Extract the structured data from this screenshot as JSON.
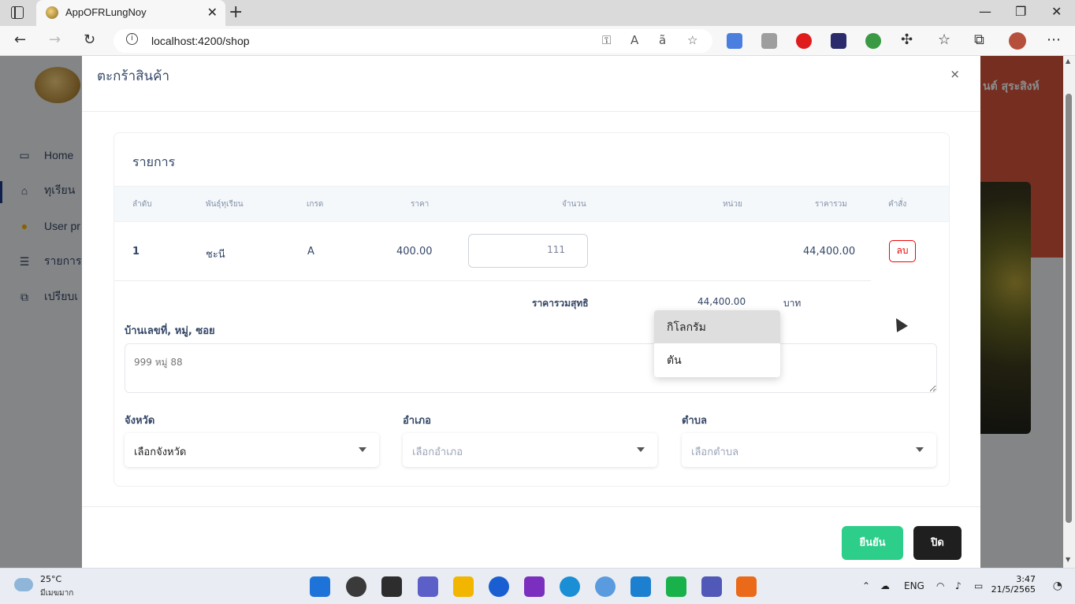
{
  "browser": {
    "tab_title": "AppOFRLungNoy",
    "tab_close": "✕",
    "new_tab": "+",
    "url": "localhost:4200/shop",
    "window_controls": [
      "—",
      "❐",
      "✕"
    ]
  },
  "background_page": {
    "sidebar": [
      {
        "label": "Home",
        "icon": "monitor-icon"
      },
      {
        "label": "ทุเรียน",
        "icon": "shop-icon"
      },
      {
        "label": "User pr",
        "icon": "user-icon"
      },
      {
        "label": "รายการ",
        "icon": "list-icon"
      },
      {
        "label": "เปรียบเ",
        "icon": "compare-icon"
      }
    ],
    "user_name": "นต์ สุระสิงห์"
  },
  "modal": {
    "title": "ตะกร้าสินค้า",
    "close_symbol": "×",
    "card_title": "รายการ",
    "columns": [
      "ลำดับ",
      "พันธุ์ทุเรียน",
      "เกรด",
      "ราคา",
      "จำนวน",
      "หน่วย",
      "ราคารวม",
      "คำสั่ง"
    ],
    "row": {
      "index": "1",
      "variety": "ชะนี",
      "grade": "A",
      "price": "400.00",
      "quantity": "111",
      "line_total": "44,400.00",
      "delete_label": "ลบ"
    },
    "unit_dropdown": {
      "options": [
        "กิโลกรัม",
        "ตัน"
      ],
      "highlighted": "กิโลกรัม"
    },
    "net_total_label": "ราคารวมสุทธิ",
    "net_total_value": "44,400.00",
    "currency": "บาท",
    "address_label": "บ้านเลขที่, หมู่, ซอย",
    "address_placeholder": "999 หมู่ 88",
    "province_label": "จังหวัด",
    "province_value": "เลือกจังหวัด",
    "district_label": "อำเภอ",
    "district_placeholder": "เลือกอำเภอ",
    "subdistrict_label": "ตำบล",
    "subdistrict_placeholder": "เลือกตำบล",
    "confirm_label": "ยืนยัน",
    "close_label": "ปิด"
  },
  "taskbar": {
    "temperature": "25°C",
    "weather": "มีเมฆมาก",
    "language": "ENG",
    "time": "3:47",
    "date": "21/5/2565"
  },
  "colors": {
    "confirm": "#2dce89",
    "close": "#1f1f1f",
    "delete": "#ea0606",
    "header_accent": "#d6543a"
  }
}
